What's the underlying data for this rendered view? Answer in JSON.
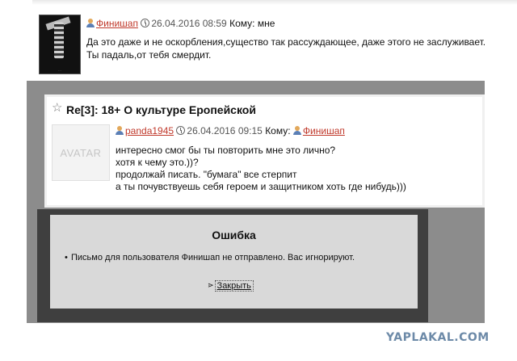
{
  "top_message": {
    "author": "Финишап",
    "datetime": "26.04.2016 08:59",
    "recipient_label": "Кому:",
    "recipient": "мне",
    "lines": [
      "Да это даже и не оскорбления,существо так рассуждающее, даже этого не заслуживает.",
      "Ты падаль,от тебя смердит."
    ]
  },
  "thread": {
    "title": "Re[3]: 18+ О культуре Еропейской",
    "avatar_placeholder": "AVATAR",
    "author": "panda1945",
    "datetime": "26.04.2016 09:15",
    "recipient_label": "Кому:",
    "recipient": "Финишап",
    "lines": [
      "интересно смог бы ты повторить мне это лично?",
      "хотя к чему это.))?",
      "продолжай писать. \"бумага\" все стерпит",
      "а ты почувствуешь себя героем и защитником хоть где нибудь)))"
    ]
  },
  "dialog": {
    "title": "Ошибка",
    "message": "Письмо для пользователя Финишап не отправлено. Вас игнорируют.",
    "close_label": "Закрыть"
  },
  "watermark": "YAPLAKAL.COM",
  "colors": {
    "username": "#c0392b",
    "overlay": "#8c8c8c",
    "dialog_bg": "#d9d9d9",
    "watermark": "#6d8aa8"
  }
}
